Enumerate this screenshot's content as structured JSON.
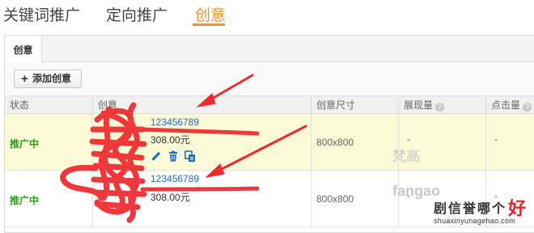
{
  "top_tabs": [
    {
      "label": "关键词推广"
    },
    {
      "label": "定向推广"
    },
    {
      "label": "创意"
    }
  ],
  "accent_color": "#f3922c",
  "sub_tab": {
    "label": "创意"
  },
  "toolbar": {
    "add_label": "添加创意"
  },
  "table": {
    "headers": [
      "状态",
      "创意",
      "创意尺寸",
      "展现量",
      "点击量"
    ],
    "rows": [
      {
        "status": "推广中",
        "id": "123456789",
        "price": "308.00元",
        "size": "800x800",
        "impressions": "-",
        "clicks": "-"
      },
      {
        "status": "推广中",
        "id": "123456789",
        "price": "308.00元",
        "size": "800x800",
        "impressions": "-",
        "clicks": "-"
      }
    ],
    "row_actions": [
      {
        "icon": "pencil-icon"
      },
      {
        "icon": "trash-icon"
      },
      {
        "icon": "copy-icon"
      }
    ]
  },
  "watermarks": {
    "cn": "梵高",
    "en": "fangao"
  },
  "brand": {
    "name": "剧信誉哪个",
    "name_highlight": "好",
    "url": "shuaxinyunagehao.com"
  }
}
